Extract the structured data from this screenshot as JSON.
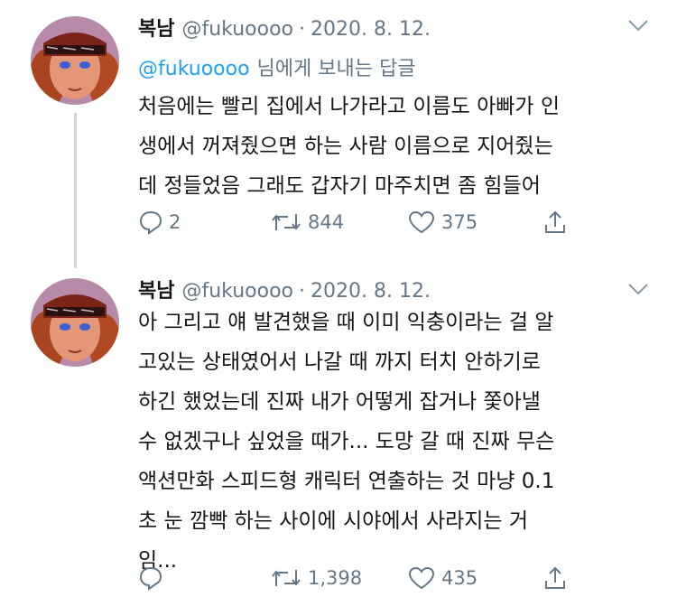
{
  "tweets": [
    {
      "name": "복남",
      "handle": "@fukuoooo",
      "sep": "·",
      "date": "2020. 8. 12.",
      "reply_mention": "@fukuoooo",
      "reply_text": "님에게 보내는 답글",
      "lines": [
        "처음에는 빨리 집에서 나가라고 이름도 아빠가 인",
        "생에서 꺼져줬으면 하는 사람 이름으로 지어줬는",
        "데 정들었음 그래도 갑자기 마주치면 좀 힘들어"
      ],
      "replies": "2",
      "retweets": "844",
      "likes": "375"
    },
    {
      "name": "복남",
      "handle": "@fukuoooo",
      "sep": "·",
      "date": "2020. 8. 12.",
      "lines": [
        "아 그리고 얘 발견했을 때 이미 익충이라는 걸 알",
        "고있는 상태였어서 나갈 때 까지 터치 안하기로",
        "하긴 했었는데 진짜 내가 어떻게 잡거나 쫓아낼",
        "수 없겠구나 싶었을 때가... 도망 갈 때 진짜 무슨",
        "액션만화 스피드형 캐릭터 연출하는 것 마냥 0.1",
        "초 눈 깜빡 하는 사이에 시야에서 사라지는 거",
        "임..."
      ],
      "replies": "",
      "retweets": "1,398",
      "likes": "435"
    }
  ],
  "colors": {
    "link": "#1da1f2",
    "secondary": "#657786",
    "text": "#14171a",
    "thread_line": "#ccd6dd"
  },
  "icons": [
    "avatar",
    "chevron-down-icon",
    "reply-icon",
    "retweet-icon",
    "like-icon",
    "share-icon"
  ]
}
